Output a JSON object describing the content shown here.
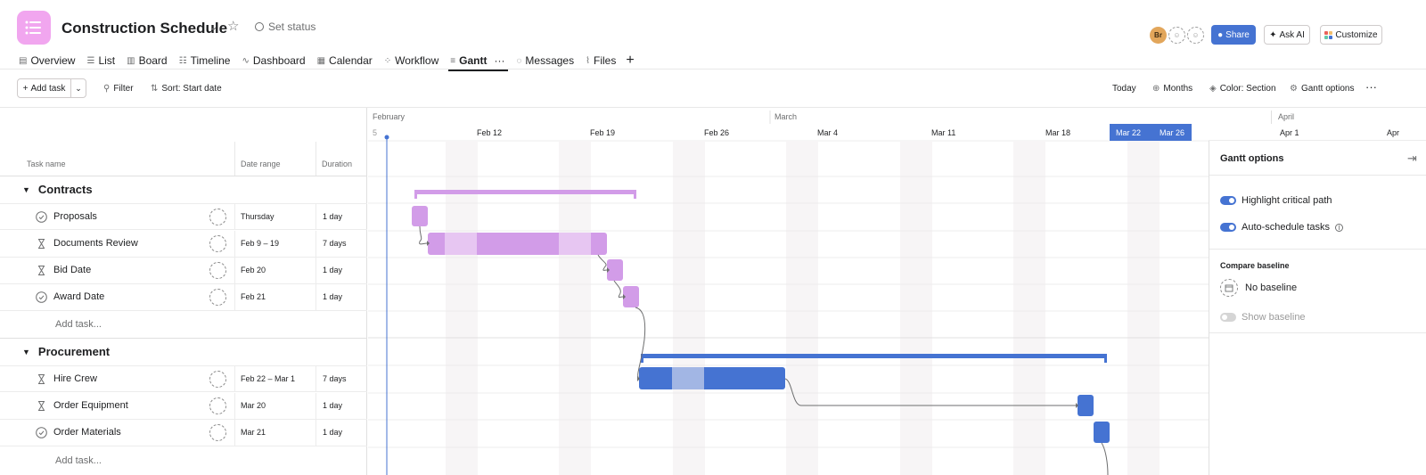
{
  "project": {
    "title": "Construction Schedule",
    "set_status": "Set status"
  },
  "header": {
    "avatar_initials": "Br",
    "share": "Share",
    "ask_ai": "Ask AI",
    "customize": "Customize"
  },
  "tabs": [
    {
      "label": "Overview",
      "icon": "overview-icon"
    },
    {
      "label": "List",
      "icon": "list-icon"
    },
    {
      "label": "Board",
      "icon": "board-icon"
    },
    {
      "label": "Timeline",
      "icon": "timeline-icon"
    },
    {
      "label": "Dashboard",
      "icon": "dashboard-icon"
    },
    {
      "label": "Calendar",
      "icon": "calendar-icon"
    },
    {
      "label": "Workflow",
      "icon": "workflow-icon"
    },
    {
      "label": "Gantt",
      "icon": "gantt-icon",
      "active": true
    },
    {
      "label": "Messages",
      "icon": "messages-icon"
    },
    {
      "label": "Files",
      "icon": "files-icon"
    }
  ],
  "toolbar": {
    "add_task": "Add task",
    "filter": "Filter",
    "sort": "Sort: Start date",
    "today": "Today",
    "months": "Months",
    "color": "Color: Section",
    "gantt_options": "Gantt options"
  },
  "columns": {
    "task_name": "Task name",
    "date_range": "Date range",
    "duration": "Duration"
  },
  "sections": [
    {
      "name": "Contracts",
      "tasks": [
        {
          "name": "Proposals",
          "type": "check",
          "date": "Thursday",
          "duration": "1 day"
        },
        {
          "name": "Documents Review",
          "type": "hourglass",
          "date": "Feb 9 – 19",
          "duration": "7 days"
        },
        {
          "name": "Bid Date",
          "type": "hourglass",
          "date": "Feb 20",
          "duration": "1 day"
        },
        {
          "name": "Award Date",
          "type": "check",
          "date": "Feb 21",
          "duration": "1 day"
        }
      ],
      "add_task": "Add task..."
    },
    {
      "name": "Procurement",
      "tasks": [
        {
          "name": "Hire Crew",
          "type": "hourglass",
          "date": "Feb 22 – Mar 1",
          "duration": "7 days"
        },
        {
          "name": "Order Equipment",
          "type": "hourglass",
          "date": "Mar 20",
          "duration": "1 day"
        },
        {
          "name": "Order Materials",
          "type": "check",
          "date": "Mar 21",
          "duration": "1 day"
        }
      ],
      "add_task": "Add task..."
    }
  ],
  "timeline": {
    "months": [
      "February",
      "March",
      "April"
    ],
    "week_labels": [
      "5",
      "Feb 12",
      "Feb 19",
      "Feb 26",
      "Mar 4",
      "Mar 11",
      "Mar 18",
      "Mar 22",
      "Mar 26",
      "Apr 1",
      "Apr"
    ],
    "highlight_color": "#4573d2",
    "contracts_color": "#d29ce8",
    "procurement_color": "#4573d2"
  },
  "panel": {
    "title": "Gantt options",
    "highlight_critical_path": "Highlight critical path",
    "auto_schedule": "Auto-schedule tasks",
    "compare_baseline": "Compare baseline",
    "no_baseline": "No baseline",
    "show_baseline": "Show baseline"
  }
}
